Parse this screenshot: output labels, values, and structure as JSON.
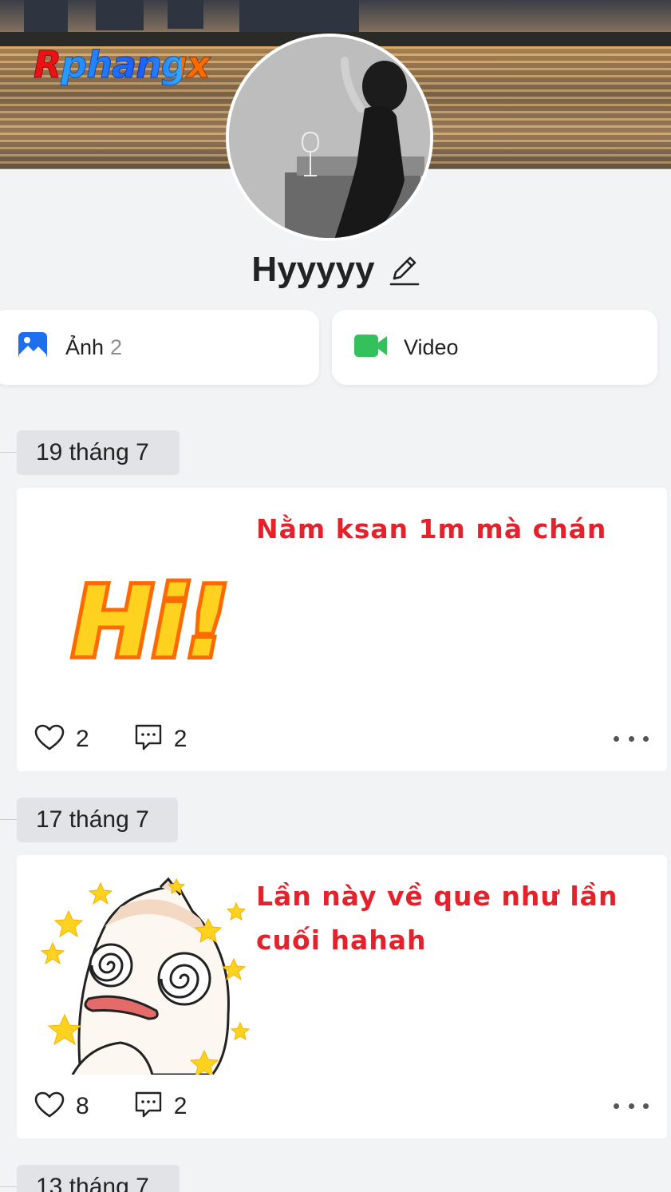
{
  "cover": {
    "watermark": "Rphangx"
  },
  "profile": {
    "name": "Hyyyyy"
  },
  "media": {
    "photos": {
      "label": "Ảnh",
      "count": "2"
    },
    "videos": {
      "label": "Video"
    }
  },
  "posts": [
    {
      "date": "19 tháng 7",
      "caption": "Nằm ksan 1m mà chán",
      "sticker_text": "Hi!",
      "likes": "2",
      "comments": "2"
    },
    {
      "date": "17 tháng 7",
      "caption": "Lần này về que như lần cuối hahah",
      "likes": "8",
      "comments": "2"
    },
    {
      "date": "13 tháng 7"
    }
  ],
  "colors": {
    "caption_red": "#e5222b",
    "photo_blue": "#1e6ff0",
    "video_green": "#34c15b",
    "background": "#f2f3f5"
  },
  "icons": [
    "photo-icon",
    "video-camera-icon",
    "pencil-icon",
    "heart-icon",
    "comment-icon",
    "more-icon"
  ]
}
